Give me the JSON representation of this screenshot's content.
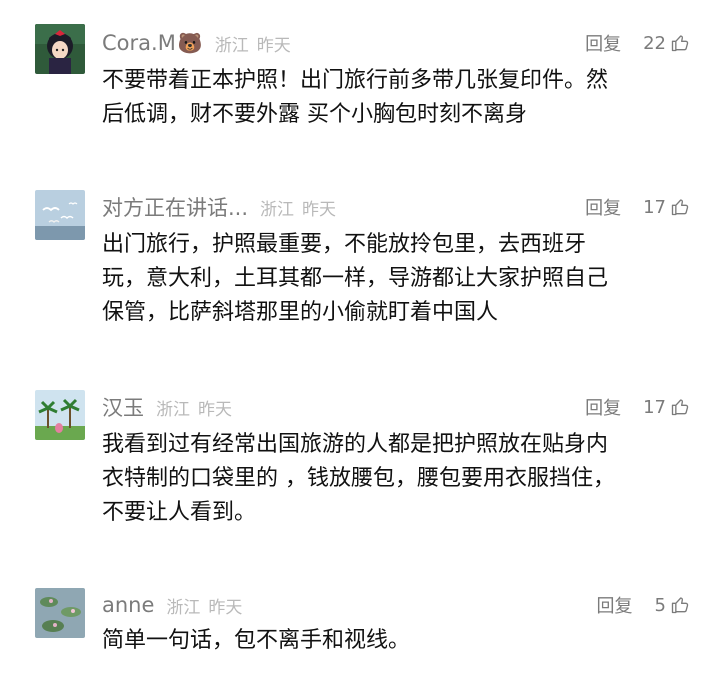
{
  "comments": [
    {
      "username": "Cora.M",
      "emoji": "🐻",
      "location": "浙江",
      "time": "昨天",
      "reply_label": "回复",
      "likes": "22",
      "avatar_icon": "anime-girl-avatar",
      "lines": [
        "不要带着正本护照！出门旅行前多带几张复印件。然",
        "后低调，财不要外露 买个小胸包时刻不离身"
      ]
    },
    {
      "username": "对方正在讲话...",
      "location": "浙江",
      "time": "昨天",
      "reply_label": "回复",
      "likes": "17",
      "avatar_icon": "seagulls-sky-avatar",
      "lines": [
        "出门旅行，护照最重要，不能放拎包里，去西班牙",
        "玩，意大利，土耳其都一样，导游都让大家护照自己",
        "保管，比萨斜塔那里的小偷就盯着中国人"
      ]
    },
    {
      "username": "汉玉",
      "location": "浙江",
      "time": "昨天",
      "reply_label": "回复",
      "likes": "17",
      "avatar_icon": "palm-trees-avatar",
      "lines": [
        "我看到过有经常出国旅游的人都是把护照放在贴身内",
        "衣特制的口袋里的 ，钱放腰包，腰包要用衣服挡住，",
        "不要让人看到。"
      ]
    },
    {
      "username": "anne",
      "location": "浙江",
      "time": "昨天",
      "reply_label": "回复",
      "likes": "5",
      "avatar_icon": "water-lilies-avatar",
      "lines": [
        "简单一句话，包不离手和视线。"
      ]
    }
  ],
  "colors": {
    "username": "#7b7b7b",
    "meta": "#b9b9b9",
    "body": "#111111",
    "background": "#ffffff"
  }
}
